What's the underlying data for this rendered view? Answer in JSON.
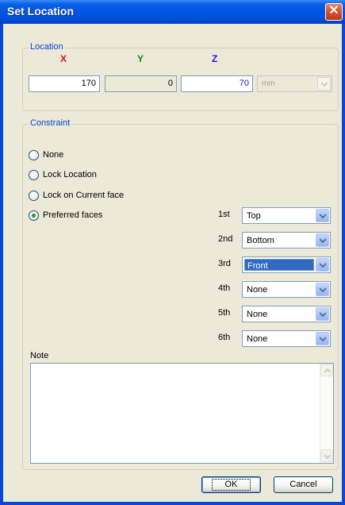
{
  "window": {
    "title": "Set Location"
  },
  "location": {
    "group_label": "Location",
    "axes": [
      {
        "label": "X",
        "color": "#e01010",
        "value": "170",
        "editable": true
      },
      {
        "label": "Y",
        "color": "#0d8a0d",
        "value": "0",
        "editable": false
      },
      {
        "label": "Z",
        "color": "#1a1ad8",
        "value": "70",
        "editable": true
      }
    ],
    "unit": "mm"
  },
  "constraint": {
    "group_label": "Constraint",
    "options": [
      {
        "label": "None",
        "selected": false
      },
      {
        "label": "Lock Location",
        "selected": false
      },
      {
        "label": "Lock on Current face",
        "selected": false
      },
      {
        "label": "Preferred faces",
        "selected": true
      }
    ],
    "faces": [
      {
        "label": "1st",
        "value": "Top"
      },
      {
        "label": "2nd",
        "value": "Bottom"
      },
      {
        "label": "3rd",
        "value": "Front",
        "focused": true
      },
      {
        "label": "4th",
        "value": "None"
      },
      {
        "label": "5th",
        "value": "None"
      },
      {
        "label": "6th",
        "value": "None"
      }
    ]
  },
  "note": {
    "label": "Note",
    "value": ""
  },
  "buttons": {
    "ok": "OK",
    "cancel": "Cancel"
  }
}
